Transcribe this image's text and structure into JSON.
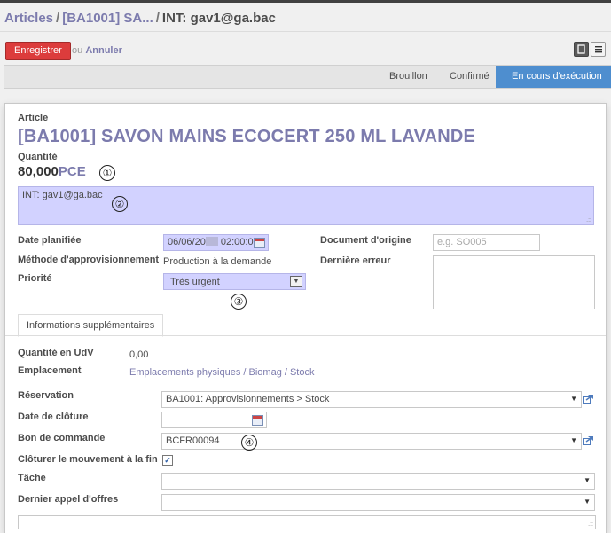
{
  "breadcrumb": {
    "root": "Articles",
    "product": "[BA1001] SA...",
    "current": "INT: gav1@ga.bac"
  },
  "toolbar": {
    "save_label": "Enregistrer",
    "or_label": "ou",
    "cancel_label": "Annuler"
  },
  "statusbar": {
    "steps": [
      "Brouillon",
      "Confirmé",
      "En cours d'exécution"
    ],
    "active_index": 2,
    "active_color": "#4e8ecf"
  },
  "form": {
    "product_label": "Article",
    "product_name": "[BA1001] SAVON MAINS ECOCERT 250 ML LAVANDE",
    "quantity_label": "Quantité",
    "quantity_value": "80,000",
    "quantity_uom": "PCE",
    "name_value": "INT: gav1@ga.bac",
    "date_planned_label": "Date planifiée",
    "date_planned_value": "06/06/20",
    "date_planned_time": "02:00:00",
    "procure_method_label": "Méthode d'approvisionnement",
    "procure_method_value": "Production à la demande",
    "priority_label": "Priorité",
    "priority_value": "Très urgent",
    "origin_label": "Document d'origine",
    "origin_placeholder": "e.g. SO005",
    "last_error_label": "Dernière erreur"
  },
  "annotations": [
    "①",
    "②",
    "③",
    "④"
  ],
  "tabs": [
    {
      "label": "Informations supplémentaires"
    }
  ],
  "extra": {
    "uos_qty_label": "Quantité en UdV",
    "uos_qty_value": "0,00",
    "location_label": "Emplacement",
    "location_value": "Emplacements physiques / Biomag / Stock",
    "reservation_label": "Réservation",
    "reservation_value": "BA1001: Approvisionnements > Stock",
    "close_date_label": "Date de clôture",
    "purchase_order_label": "Bon de commande",
    "purchase_order_value": "BCFR00094",
    "close_move_label": "Clôturer le mouvement à la fin",
    "close_move_checked": true,
    "task_label": "Tâche",
    "task_value": "",
    "last_tender_label": "Dernier appel d'offres",
    "last_tender_value": ""
  },
  "colors": {
    "accent": "#7c7bad",
    "save_button": "#dc3c3c",
    "required_field": "#d2d2ff"
  },
  "icons": [
    "form-view-icon",
    "list-view-icon",
    "calendar-icon",
    "external-link-icon",
    "dropdown-caret-icon",
    "checkmark-icon"
  ]
}
